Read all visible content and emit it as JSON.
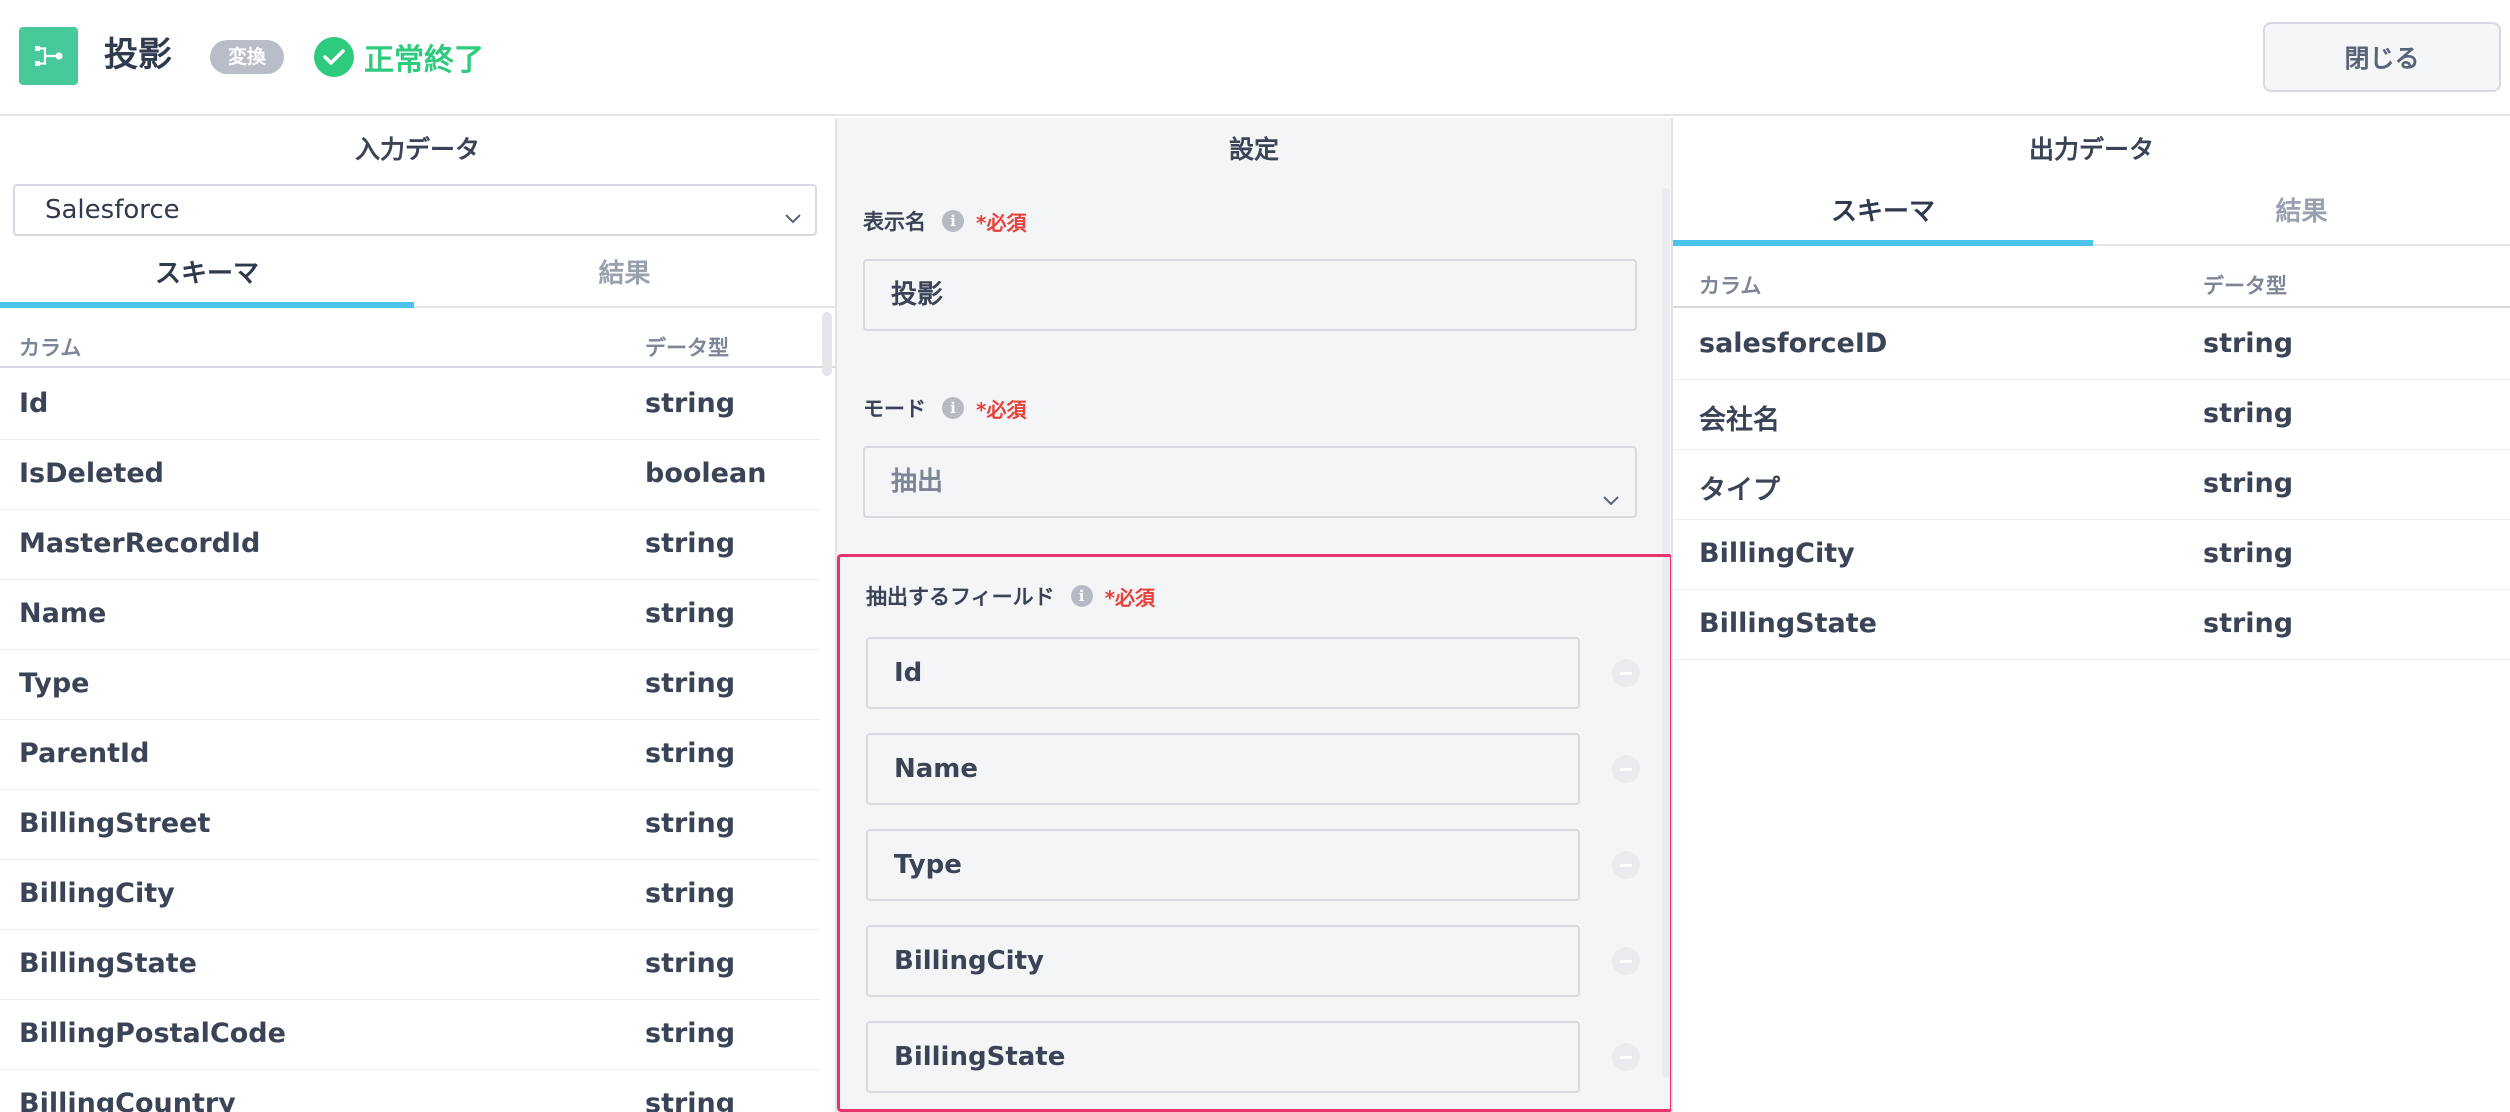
{
  "header": {
    "title": "投影",
    "type_badge": "変換",
    "status": "正常終了",
    "close_label": "閉じる",
    "colors": {
      "node_icon": "#48c99a",
      "status": "#2ecb7f"
    }
  },
  "input_panel": {
    "title": "入力データ",
    "source": "Salesforce",
    "tabs": [
      "スキーマ",
      "結果"
    ],
    "active_tab": "スキーマ",
    "columns_header": {
      "name": "カラム",
      "type": "データ型"
    },
    "rows": [
      {
        "name": "Id",
        "type": "string"
      },
      {
        "name": "IsDeleted",
        "type": "boolean"
      },
      {
        "name": "MasterRecordId",
        "type": "string"
      },
      {
        "name": "Name",
        "type": "string"
      },
      {
        "name": "Type",
        "type": "string"
      },
      {
        "name": "ParentId",
        "type": "string"
      },
      {
        "name": "BillingStreet",
        "type": "string"
      },
      {
        "name": "BillingCity",
        "type": "string"
      },
      {
        "name": "BillingState",
        "type": "string"
      },
      {
        "name": "BillingPostalCode",
        "type": "string"
      },
      {
        "name": "BillingCountry",
        "type": "string"
      }
    ]
  },
  "settings_panel": {
    "title": "設定",
    "display_name": {
      "label": "表示名",
      "required": "*必須",
      "value": "投影"
    },
    "mode": {
      "label": "モード",
      "required": "*必須",
      "value": "抽出"
    },
    "extract_fields": {
      "label": "抽出するフィールド",
      "required": "*必須",
      "values": [
        "Id",
        "Name",
        "Type",
        "BillingCity",
        "BillingState"
      ]
    }
  },
  "output_panel": {
    "title": "出力データ",
    "tabs": [
      "スキーマ",
      "結果"
    ],
    "active_tab": "スキーマ",
    "columns_header": {
      "name": "カラム",
      "type": "データ型"
    },
    "rows": [
      {
        "name": "salesforceID",
        "type": "string"
      },
      {
        "name": "会社名",
        "type": "string"
      },
      {
        "name": "タイプ",
        "type": "string"
      },
      {
        "name": "BillingCity",
        "type": "string"
      },
      {
        "name": "BillingState",
        "type": "string"
      }
    ]
  }
}
